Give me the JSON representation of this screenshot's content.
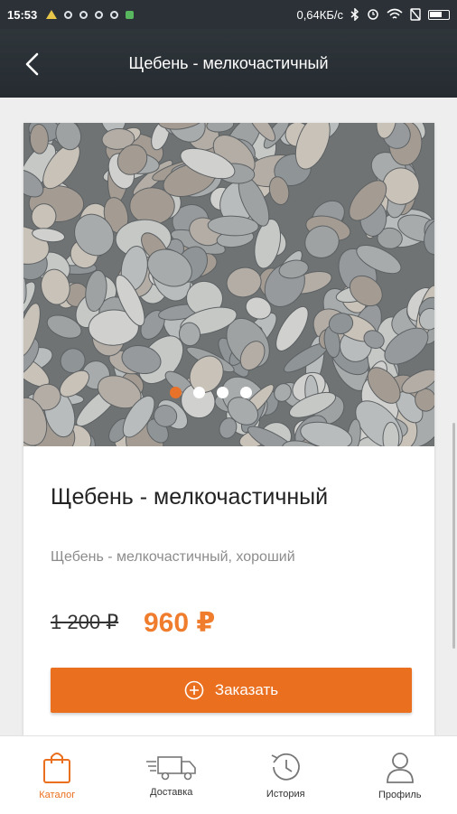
{
  "statusbar": {
    "time": "15:53",
    "speed": "0,64КБ/с"
  },
  "header": {
    "title": "Щебень - мелкочастичный"
  },
  "product": {
    "title": "Щебень - мелкочастичный",
    "description": "Щебень - мелкочастичный, хороший",
    "old_price": "1 200 ₽",
    "price": "960 ₽",
    "order_label": "Заказать",
    "gallery_count": 4,
    "gallery_active": 1
  },
  "nav": {
    "items": [
      {
        "label": "Каталог",
        "icon": "shopping-bag-icon",
        "active": true
      },
      {
        "label": "Доставка",
        "icon": "delivery-truck-icon",
        "active": false
      },
      {
        "label": "История",
        "icon": "history-icon",
        "active": false
      },
      {
        "label": "Профиль",
        "icon": "profile-icon",
        "active": false
      }
    ]
  },
  "colors": {
    "accent": "#ea6f1e",
    "header": "#2b3136"
  }
}
